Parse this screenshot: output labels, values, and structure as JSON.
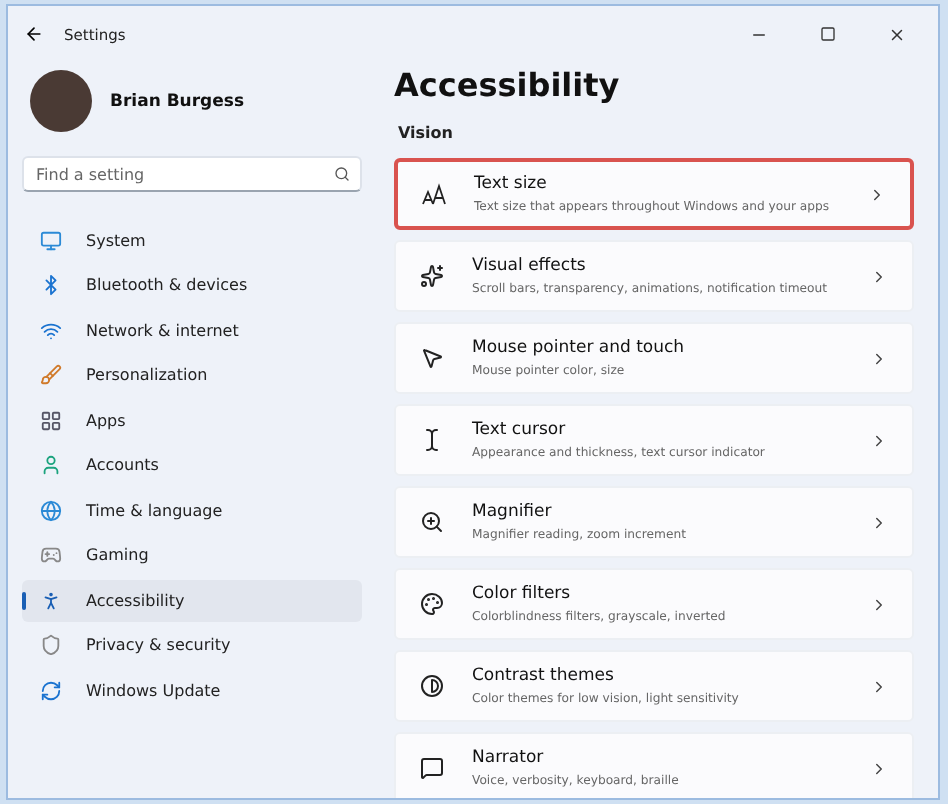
{
  "window": {
    "title": "Settings"
  },
  "profile": {
    "name": "Brian Burgess"
  },
  "search": {
    "placeholder": "Find a setting"
  },
  "sidebar": {
    "items": [
      {
        "label": "System",
        "selected": false
      },
      {
        "label": "Bluetooth & devices",
        "selected": false
      },
      {
        "label": "Network & internet",
        "selected": false
      },
      {
        "label": "Personalization",
        "selected": false
      },
      {
        "label": "Apps",
        "selected": false
      },
      {
        "label": "Accounts",
        "selected": false
      },
      {
        "label": "Time & language",
        "selected": false
      },
      {
        "label": "Gaming",
        "selected": false
      },
      {
        "label": "Accessibility",
        "selected": true
      },
      {
        "label": "Privacy & security",
        "selected": false
      },
      {
        "label": "Windows Update",
        "selected": false
      }
    ]
  },
  "page": {
    "title": "Accessibility",
    "section": "Vision",
    "items": [
      {
        "title": "Text size",
        "subtitle": "Text size that appears throughout Windows and your apps",
        "highlighted": true
      },
      {
        "title": "Visual effects",
        "subtitle": "Scroll bars, transparency, animations, notification timeout",
        "highlighted": false
      },
      {
        "title": "Mouse pointer and touch",
        "subtitle": "Mouse pointer color, size",
        "highlighted": false
      },
      {
        "title": "Text cursor",
        "subtitle": "Appearance and thickness, text cursor indicator",
        "highlighted": false
      },
      {
        "title": "Magnifier",
        "subtitle": "Magnifier reading, zoom increment",
        "highlighted": false
      },
      {
        "title": "Color filters",
        "subtitle": "Colorblindness filters, grayscale, inverted",
        "highlighted": false
      },
      {
        "title": "Contrast themes",
        "subtitle": "Color themes for low vision, light sensitivity",
        "highlighted": false
      },
      {
        "title": "Narrator",
        "subtitle": "Voice, verbosity, keyboard, braille",
        "highlighted": false
      }
    ]
  }
}
